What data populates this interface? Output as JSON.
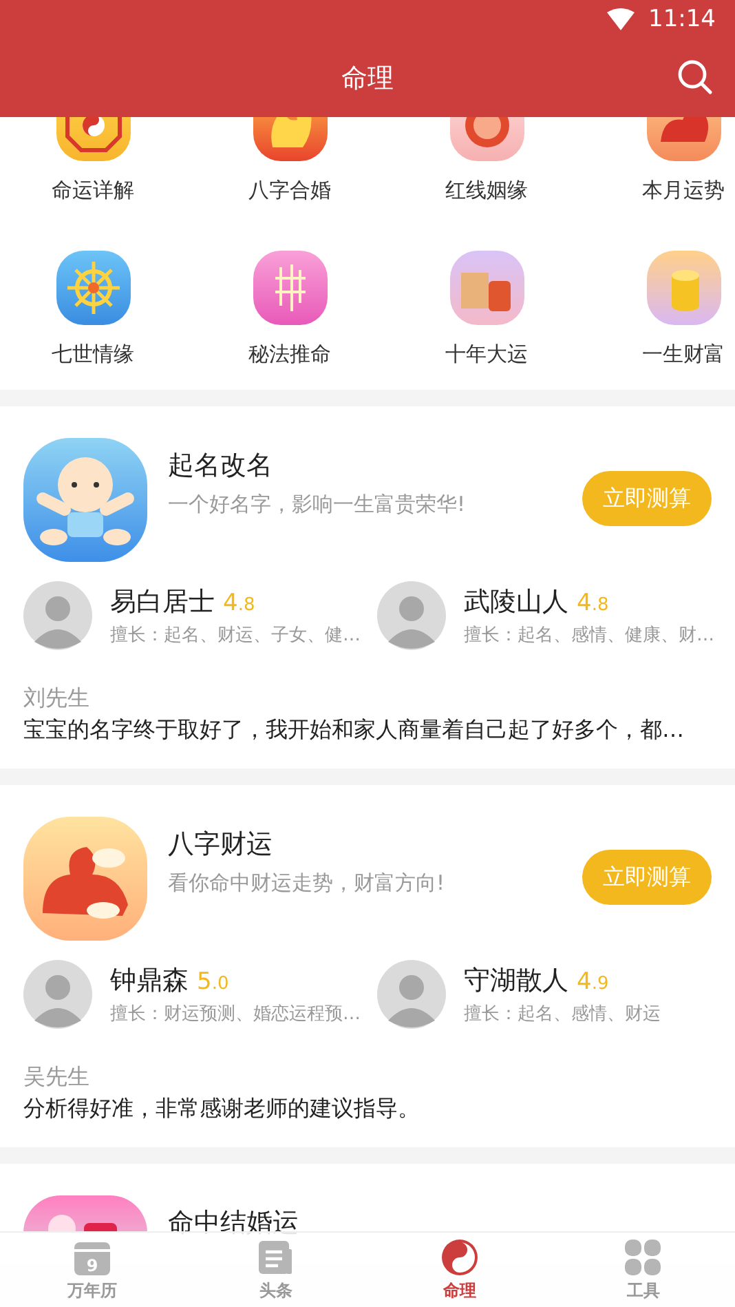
{
  "status_bar": {
    "time": "11:14"
  },
  "header": {
    "title": "命理"
  },
  "features": [
    {
      "label": "命运详解"
    },
    {
      "label": "八字合婚"
    },
    {
      "label": "红线姻缘"
    },
    {
      "label": "本月运势"
    },
    {
      "label": "七世情缘"
    },
    {
      "label": "秘法推命"
    },
    {
      "label": "十年大运"
    },
    {
      "label": "一生财富"
    }
  ],
  "cards": [
    {
      "title": "起名改名",
      "subtitle": "一个好名字，影响一生富贵荣华!",
      "button": "立即测算",
      "experts": [
        {
          "name": "易白居士",
          "rating": "4.8",
          "specialty": "擅长：起名、财运、子女、健…"
        },
        {
          "name": "武陵山人",
          "rating": "4.8",
          "specialty": "擅长：起名、感情、健康、财…"
        }
      ],
      "review": {
        "author": "刘先生",
        "text": "宝宝的名字终于取好了，我开始和家人商量着自己起了好多个，都…"
      }
    },
    {
      "title": "八字财运",
      "subtitle": "看你命中财运走势，财富方向!",
      "button": "立即测算",
      "experts": [
        {
          "name": "钟鼎森",
          "rating": "5.0",
          "specialty": "擅长：财运预测、婚恋运程预…"
        },
        {
          "name": "守湖散人",
          "rating": "4.9",
          "specialty": "擅长：起名、感情、财运"
        }
      ],
      "review": {
        "author": "吴先生",
        "text": "分析得好准，非常感谢老师的建议指导。"
      }
    },
    {
      "title": "命中结婚运"
    }
  ],
  "nav": [
    {
      "label": "万年历",
      "badge": "9",
      "selected": false
    },
    {
      "label": "头条",
      "selected": false
    },
    {
      "label": "命理",
      "selected": true
    },
    {
      "label": "工具",
      "selected": false
    }
  ]
}
